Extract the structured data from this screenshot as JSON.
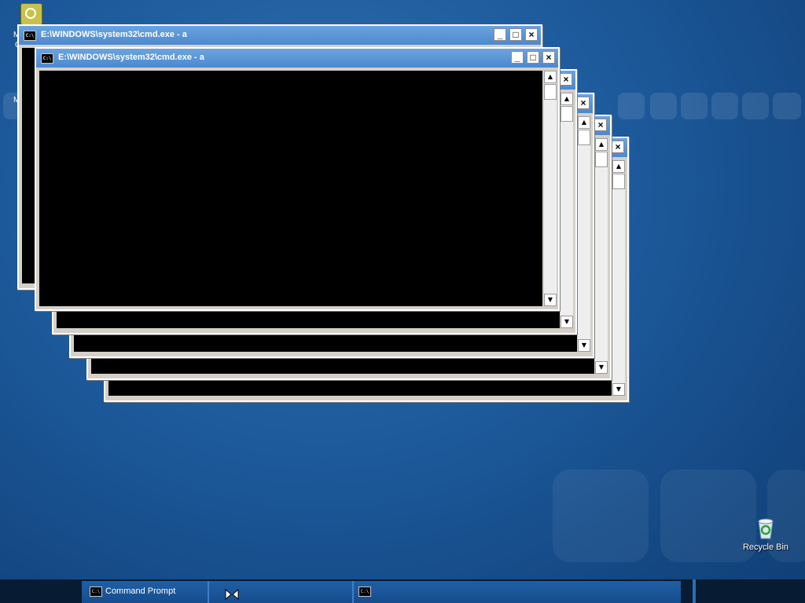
{
  "desktop": {
    "icons": [
      {
        "name": "recycle-bin",
        "label": "Recycle Bin"
      }
    ],
    "edge_labels": [
      "M",
      "C",
      "M"
    ]
  },
  "windows": [
    {
      "title": "E:\\WINDOWS\\system32\\cmd.exe - a",
      "icon": "cmd-icon"
    },
    {
      "title": "E:\\WINDOWS\\system32\\cmd.exe - a",
      "icon": "cmd-icon"
    }
  ],
  "window_buttons": {
    "minimize": "_",
    "maximize": "□",
    "close": "×"
  },
  "scroll": {
    "up": "▲",
    "down": "▼"
  },
  "icon_text": {
    "cmd": "C:\\"
  },
  "taskbar": {
    "buttons": [
      {
        "label": "Command Prompt",
        "icon": "cmd-icon"
      },
      {
        "label": "",
        "icon": "cmd-icon"
      }
    ]
  },
  "colors": {
    "title_bar": "#5a95d6",
    "console_bg": "#000000",
    "desktop_bg": "#1d5a9c",
    "taskbar_bg": "#071b33"
  }
}
